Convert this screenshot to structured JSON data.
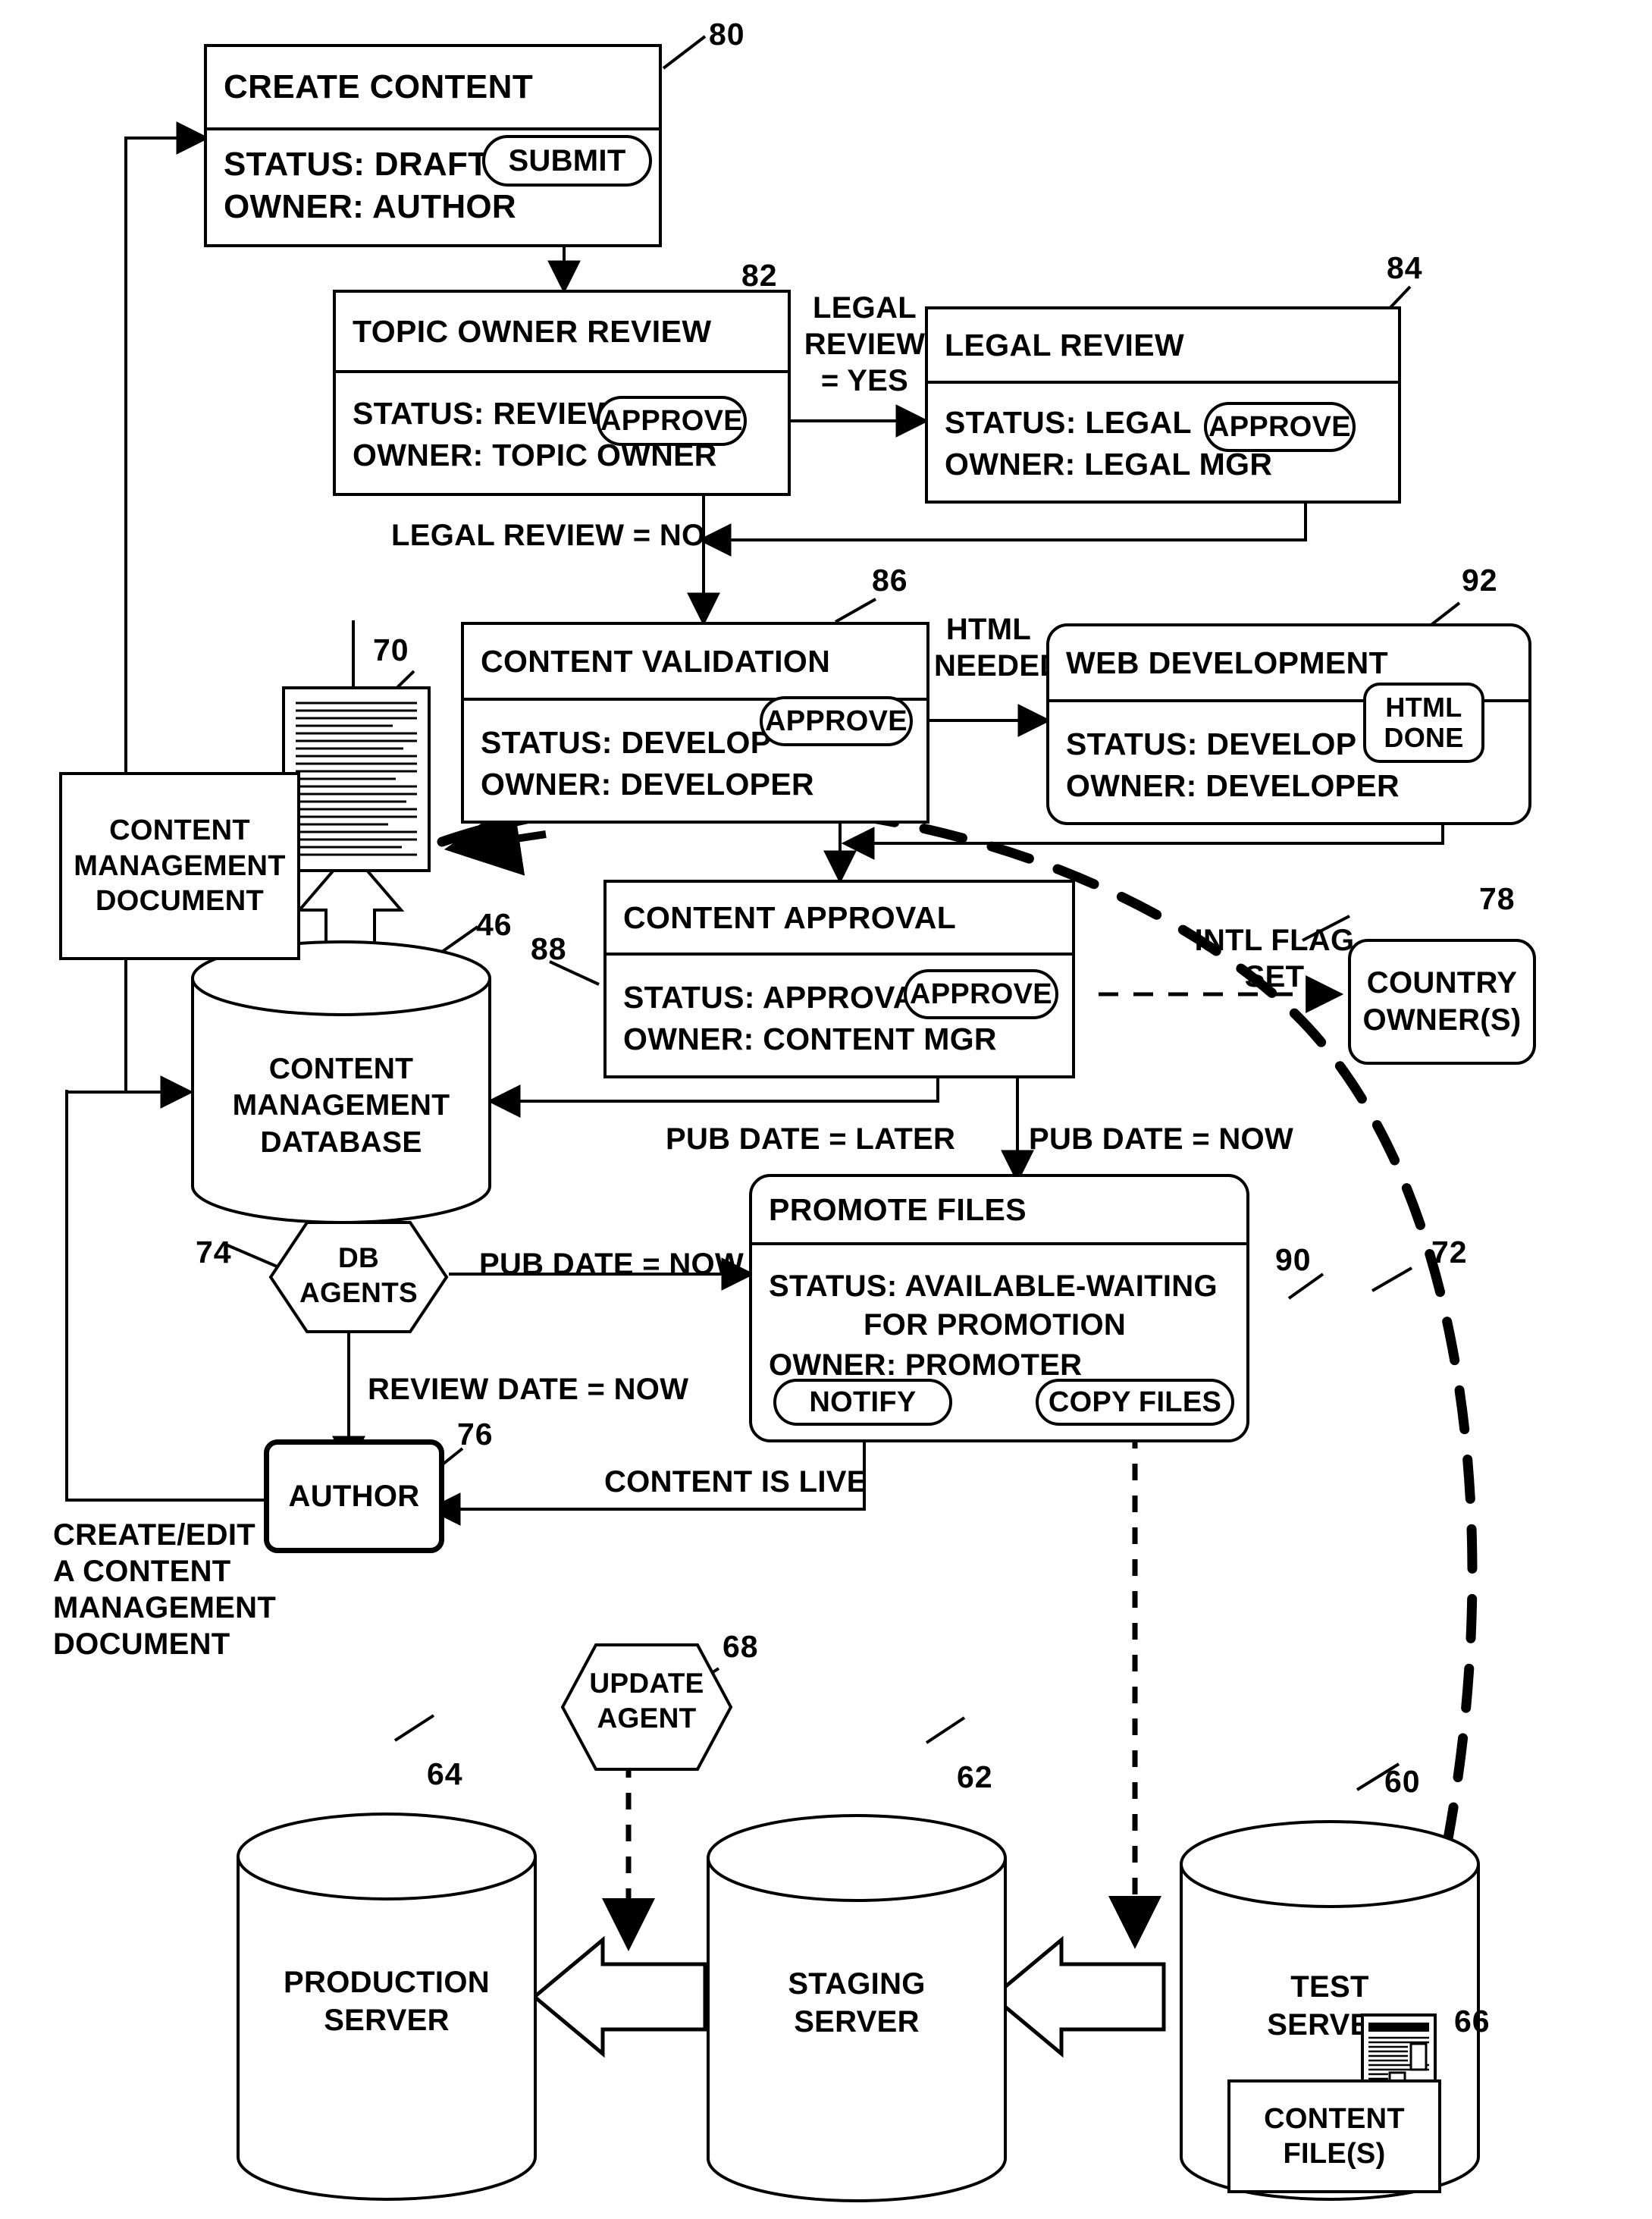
{
  "figure": {
    "type": "patent-flow-diagram",
    "title": "Content management workflow"
  },
  "nodes": {
    "create_content": {
      "ref": "80",
      "title": "CREATE CONTENT",
      "status": "STATUS: DRAFT",
      "owner": "OWNER: AUTHOR",
      "action": "SUBMIT"
    },
    "topic_owner_review": {
      "ref": "82",
      "title": "TOPIC OWNER REVIEW",
      "status": "STATUS: REVIEW",
      "owner": "OWNER: TOPIC OWNER",
      "action": "APPROVE"
    },
    "legal_review": {
      "ref": "84",
      "title": "LEGAL REVIEW",
      "status": "STATUS: LEGAL",
      "owner": "OWNER: LEGAL MGR",
      "action": "APPROVE"
    },
    "content_validation": {
      "ref": "86",
      "title": "CONTENT VALIDATION",
      "status": "STATUS: DEVELOP",
      "owner": "OWNER: DEVELOPER",
      "action": "APPROVE"
    },
    "web_development": {
      "ref": "92",
      "title": "WEB DEVELOPMENT",
      "status": "STATUS: DEVELOP",
      "owner": "OWNER: DEVELOPER",
      "action_line1": "HTML",
      "action_line2": "DONE"
    },
    "content_approval": {
      "ref": "88",
      "title": "CONTENT APPROVAL",
      "status": "STATUS: APPROVAL",
      "owner": "OWNER: CONTENT MGR",
      "action": "APPROVE"
    },
    "promote_files": {
      "ref": "90",
      "title": "PROMOTE FILES",
      "status_line1": "STATUS: AVAILABLE-WAITING",
      "status_line2": "FOR PROMOTION",
      "owner": "OWNER: PROMOTER",
      "action_notify": "NOTIFY",
      "action_copy": "COPY FILES"
    },
    "country_owners": {
      "ref": "78",
      "line1": "COUNTRY",
      "line2": "OWNER(S)"
    },
    "content_management_document": {
      "line1": "CONTENT",
      "line2": "MANAGEMENT",
      "line3": "DOCUMENT"
    },
    "document_icon": {
      "ref": "70"
    },
    "content_management_database": {
      "ref": "46",
      "line1": "CONTENT",
      "line2": "MANAGEMENT",
      "line3": "DATABASE"
    },
    "db_agents": {
      "ref": "74",
      "line1": "DB",
      "line2": "AGENTS"
    },
    "author": {
      "ref": "76",
      "label": "AUTHOR"
    },
    "update_agent": {
      "ref": "68",
      "line1": "UPDATE",
      "line2": "AGENT"
    },
    "production_server": {
      "ref": "64",
      "line1": "PRODUCTION",
      "line2": "SERVER"
    },
    "staging_server": {
      "ref": "62",
      "line1": "STAGING",
      "line2": "SERVER"
    },
    "test_server": {
      "ref": "60",
      "line1": "TEST",
      "line2": "SERVER"
    },
    "content_files": {
      "ref": "66",
      "line1": "CONTENT",
      "line2": "FILE(S)"
    },
    "boundary": {
      "ref": "72"
    }
  },
  "edge_labels": {
    "legal_review_yes": "LEGAL\nREVIEW\n= YES",
    "legal_review_no": "LEGAL REVIEW = NO",
    "html_needed": "HTML\nNEEDED",
    "intl_flag_set": "INTL FLAG\nSET",
    "pub_date_later": "PUB DATE = LATER",
    "pub_date_now_right": "PUB DATE = NOW",
    "pub_date_now_left": "PUB DATE = NOW",
    "review_date_now": "REVIEW DATE = NOW",
    "content_is_live": "CONTENT IS LIVE",
    "create_edit_doc": "CREATE/EDIT\nA CONTENT\nMANAGEMENT\nDOCUMENT"
  },
  "colors": {
    "line": "#000000",
    "background": "#ffffff"
  }
}
